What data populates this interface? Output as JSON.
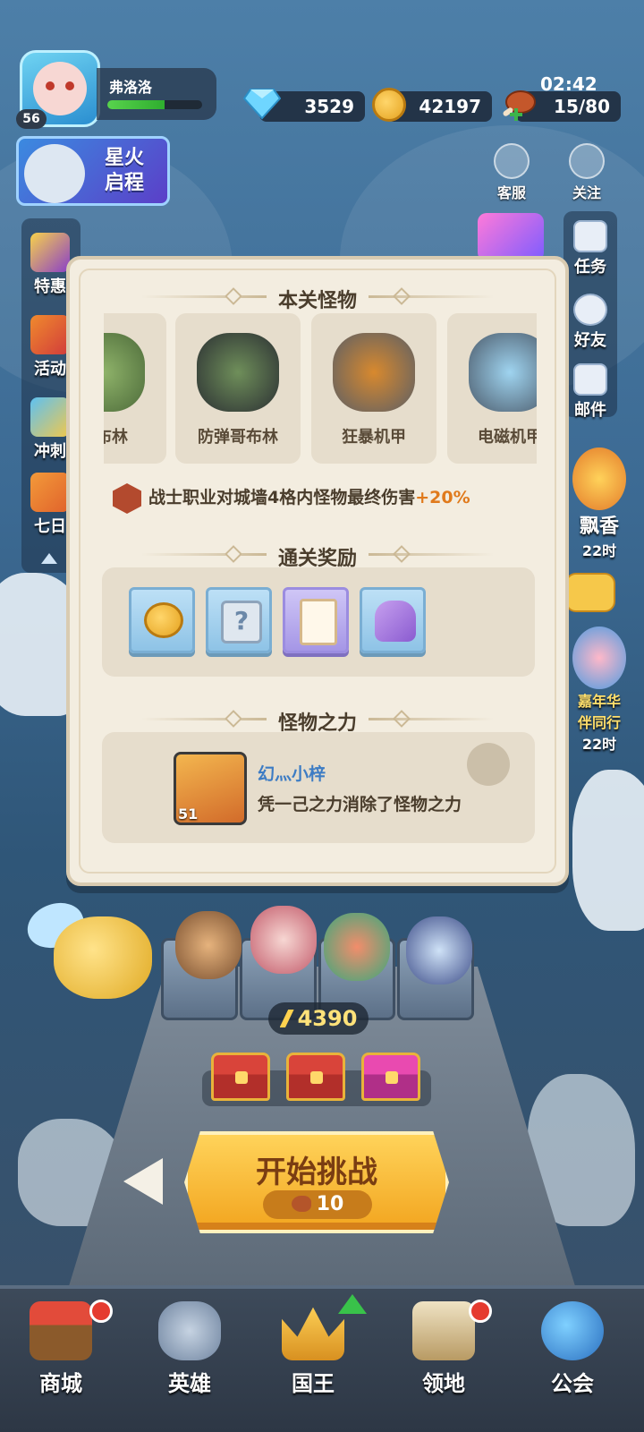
{
  "player": {
    "name": "弗洛洛",
    "level": "56",
    "xp_fraction": 0.6
  },
  "resources": {
    "gems": "3529",
    "gold": "42197",
    "stamina": "15/80",
    "timer": "02:42"
  },
  "event_banner": {
    "line1": "星火",
    "line2": "启程"
  },
  "top_icons": {
    "service": "客服",
    "follow": "关注"
  },
  "left_menu": [
    "特惠",
    "活动",
    "冲刺",
    "七日"
  ],
  "right_menu": [
    "任务",
    "好友",
    "邮件"
  ],
  "right_events": [
    {
      "label": "飘香",
      "timer": "22时"
    },
    {
      "label": "嘉年华",
      "sub": "伴同行",
      "timer": "22时"
    }
  ],
  "modal": {
    "monsters_title": "本关怪物",
    "monsters": [
      "哥布林",
      "防弹哥布林",
      "狂暴机甲",
      "电磁机甲"
    ],
    "bonus_text": "战士职业对城墙4格内怪物最终伤害",
    "bonus_pct": "+20%",
    "rewards_title": "通关奖励",
    "reward_icons": [
      "gold-coin-icon",
      "mystery-scroll-icon",
      "book-icon",
      "mystery-armor-icon"
    ],
    "power_title": "怪物之力",
    "power_player": "幻灬小梓",
    "power_player_level": "51",
    "power_desc": "凭一己之力消除了怪物之力"
  },
  "team": {
    "power": "4390"
  },
  "start": {
    "label": "开始挑战",
    "cost": "10"
  },
  "nav": [
    "商城",
    "英雄",
    "国王",
    "领地",
    "公会"
  ],
  "colors": {
    "accent_gold": "#f2a51f",
    "bonus_orange": "#e07a1c",
    "name_blue": "#3d7cc4"
  }
}
